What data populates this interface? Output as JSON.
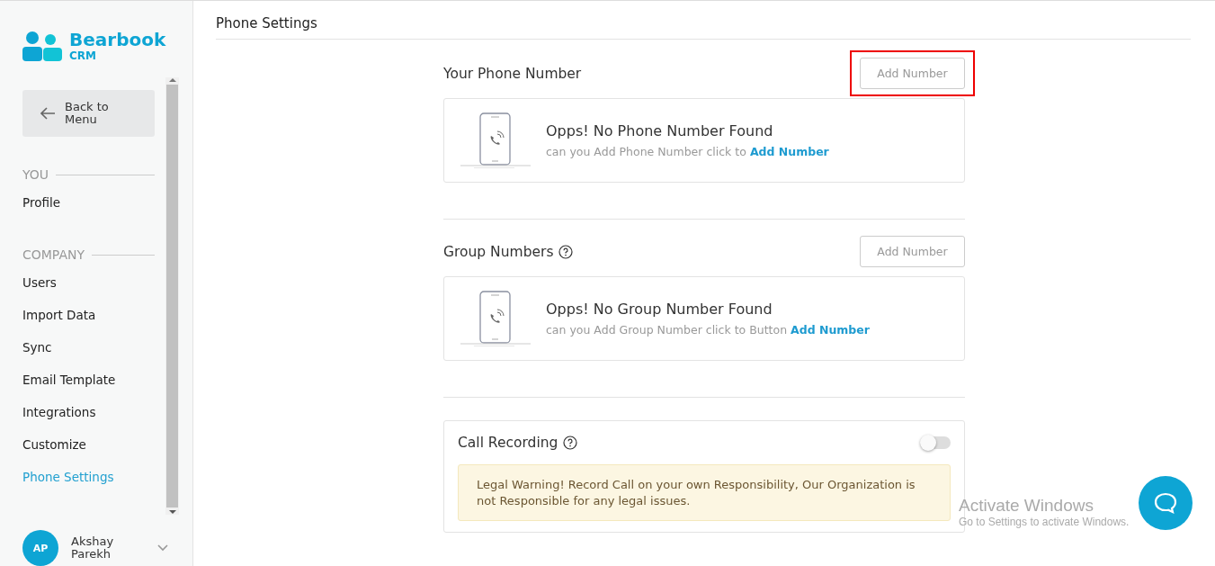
{
  "brand": {
    "name": "Bearbook",
    "sub": "CRM"
  },
  "back_button": {
    "label": "Back to Menu"
  },
  "sidebar": {
    "sections": [
      {
        "title": "YOU",
        "items": [
          {
            "label": "Profile",
            "selected": false
          }
        ]
      },
      {
        "title": "COMPANY",
        "items": [
          {
            "label": "Users",
            "selected": false
          },
          {
            "label": "Import Data",
            "selected": false
          },
          {
            "label": "Sync",
            "selected": false
          },
          {
            "label": "Email Template",
            "selected": false
          },
          {
            "label": "Integrations",
            "selected": false
          },
          {
            "label": "Customize",
            "selected": false
          },
          {
            "label": "Phone Settings",
            "selected": true
          }
        ]
      }
    ]
  },
  "user": {
    "initials": "AP",
    "name": "Akshay Parekh"
  },
  "page_title": "Phone Settings",
  "number_sections": [
    {
      "title": "Your Phone Number",
      "help": false,
      "button": {
        "label": "Add Number",
        "highlighted": true
      },
      "empty_title": "Opps! No Phone Number Found",
      "empty_text": "can you Add Phone Number click to",
      "empty_link": "Add Number"
    },
    {
      "title": "Group Numbers",
      "help": true,
      "button": {
        "label": "Add Number",
        "highlighted": false
      },
      "empty_title": "Opps! No Group Number Found",
      "empty_text": "can you Add Group Number click to Button",
      "empty_link": "Add Number"
    }
  ],
  "call_recording": {
    "title": "Call Recording",
    "help": true,
    "on": false,
    "warning": "Legal Warning! Record Call on your own Responsibility, Our Organization is not Responsible for any legal issues."
  },
  "os_notice": {
    "title": "Activate Windows",
    "text": "Go to Settings to activate Windows."
  }
}
